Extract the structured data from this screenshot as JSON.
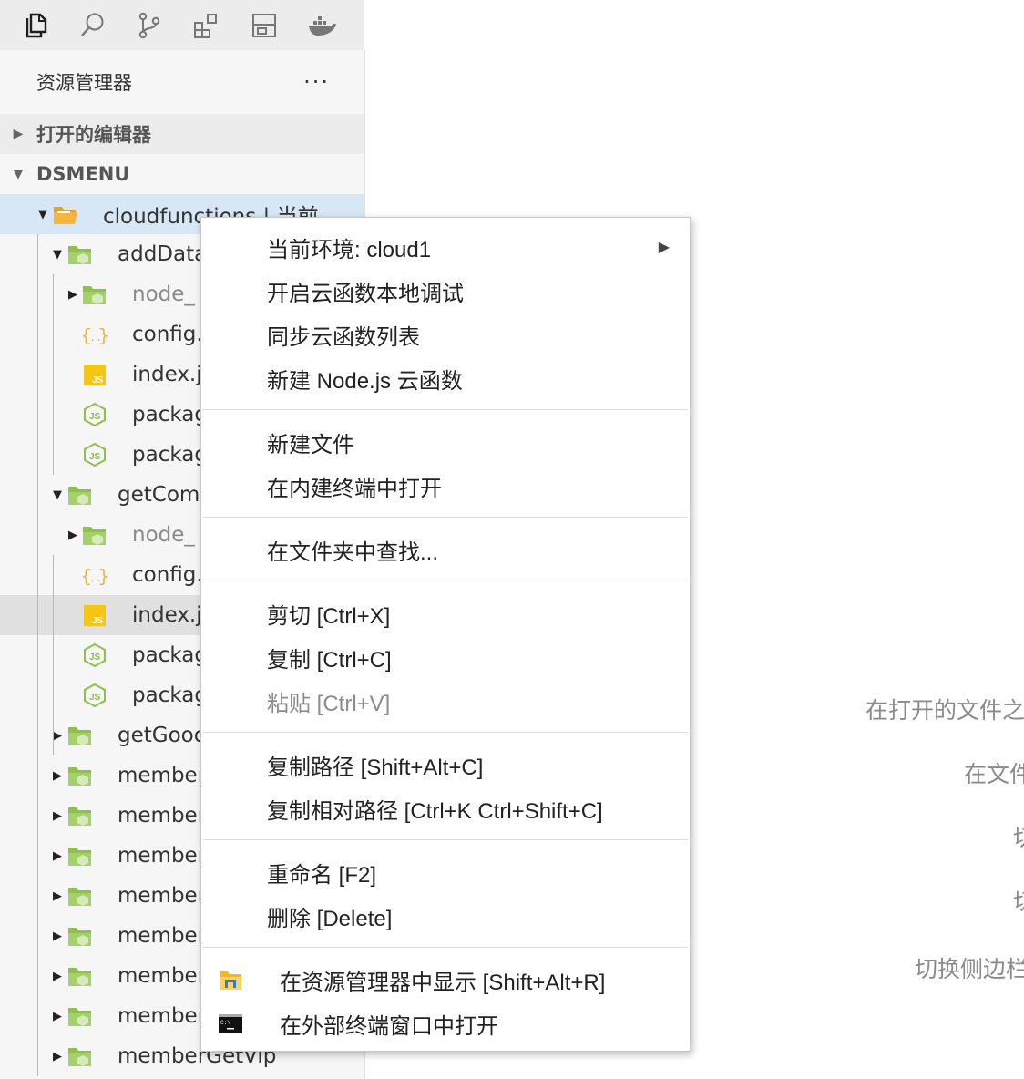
{
  "activity_bar": {
    "icons": [
      "files-icon",
      "search-icon",
      "source-control-icon",
      "extensions-icon",
      "cloud-dev-icon",
      "docker-icon"
    ]
  },
  "explorer": {
    "title": "资源管理器",
    "more": "···",
    "sections": [
      {
        "label": "打开的编辑器",
        "expanded": false
      },
      {
        "label": "DSMENU",
        "expanded": true
      }
    ]
  },
  "tree": [
    {
      "label": "cloudfunctions | 当前",
      "depth": 0,
      "type": "folder-open",
      "expanded": true,
      "selected": true
    },
    {
      "label": "addData",
      "depth": 1,
      "type": "folder",
      "expanded": true
    },
    {
      "label": "node_",
      "depth": 2,
      "type": "folder",
      "expanded": false,
      "dim": true
    },
    {
      "label": "config.",
      "depth": 2,
      "type": "json"
    },
    {
      "label": "index.j",
      "depth": 2,
      "type": "js"
    },
    {
      "label": "packag",
      "depth": 2,
      "type": "node"
    },
    {
      "label": "packag",
      "depth": 2,
      "type": "node"
    },
    {
      "label": "getCom",
      "depth": 1,
      "type": "folder",
      "expanded": true
    },
    {
      "label": "node_",
      "depth": 2,
      "type": "folder",
      "expanded": false,
      "dim": true
    },
    {
      "label": "config.",
      "depth": 2,
      "type": "json"
    },
    {
      "label": "index.j",
      "depth": 2,
      "type": "js",
      "hover": true
    },
    {
      "label": "packag",
      "depth": 2,
      "type": "node"
    },
    {
      "label": "packag",
      "depth": 2,
      "type": "node"
    },
    {
      "label": "getGooc",
      "depth": 1,
      "type": "folder",
      "expanded": false
    },
    {
      "label": "member",
      "depth": 1,
      "type": "folder",
      "expanded": false
    },
    {
      "label": "member",
      "depth": 1,
      "type": "folder",
      "expanded": false
    },
    {
      "label": "member",
      "depth": 1,
      "type": "folder",
      "expanded": false
    },
    {
      "label": "member",
      "depth": 1,
      "type": "folder",
      "expanded": false
    },
    {
      "label": "member",
      "depth": 1,
      "type": "folder",
      "expanded": false
    },
    {
      "label": "member",
      "depth": 1,
      "type": "folder",
      "expanded": false
    },
    {
      "label": "member",
      "depth": 1,
      "type": "folder",
      "expanded": false
    },
    {
      "label": "memberGetVip",
      "depth": 1,
      "type": "folder",
      "expanded": false
    }
  ],
  "context_menu": {
    "groups": [
      [
        {
          "label": "当前环境: cloud1",
          "submenu": true
        },
        {
          "label": "开启云函数本地调试"
        },
        {
          "label": "同步云函数列表"
        },
        {
          "label": "新建 Node.js 云函数"
        }
      ],
      [
        {
          "label": "新建文件"
        },
        {
          "label": "在内建终端中打开"
        }
      ],
      [
        {
          "label": "在文件夹中查找..."
        }
      ],
      [
        {
          "label": "剪切  [Ctrl+X]"
        },
        {
          "label": "复制  [Ctrl+C]"
        },
        {
          "label": "粘贴  [Ctrl+V]",
          "disabled": true
        }
      ],
      [
        {
          "label": "复制路径  [Shift+Alt+C]"
        },
        {
          "label": "复制相对路径  [Ctrl+K Ctrl+Shift+C]"
        }
      ],
      [
        {
          "label": "重命名  [F2]"
        },
        {
          "label": "删除  [Delete]"
        }
      ],
      [
        {
          "label": "在资源管理器中显示  [Shift+Alt+R]",
          "icon": "windows-explorer-icon"
        },
        {
          "label": "在外部终端窗口中打开",
          "icon": "terminal-icon"
        }
      ]
    ]
  },
  "editor_hints": [
    "在打开的文件之",
    "在文件",
    "切",
    "切",
    "切换侧边栏"
  ],
  "colors": {
    "folder_green": "#8dc149",
    "folder_open": "#f0a830",
    "js_yellow": "#f5c518",
    "json_yellow": "#e8b23a",
    "node_green": "#8dc149",
    "selection": "#d8e7f6"
  }
}
